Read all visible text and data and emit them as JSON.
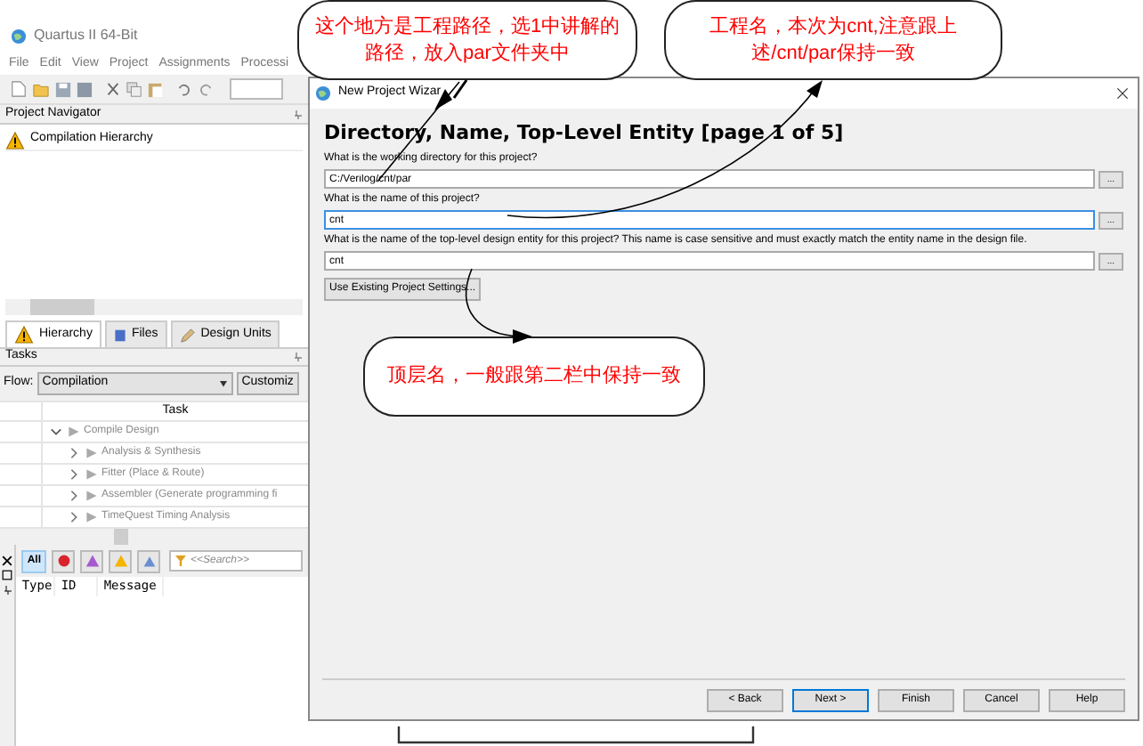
{
  "quartus": {
    "title": "Quartus II 64-Bit",
    "menu": [
      "File",
      "Edit",
      "View",
      "Project",
      "Assignments",
      "Processi"
    ],
    "navigator": {
      "title": "Project Navigator",
      "items": [
        "Compilation Hierarchy"
      ]
    },
    "tabs": [
      {
        "label": "Hierarchy",
        "selected": true
      },
      {
        "label": "Files",
        "selected": false
      },
      {
        "label": "Design Units",
        "selected": false
      }
    ],
    "tasks": {
      "title": "Tasks",
      "flow_label": "Flow:",
      "flow_value": "Compilation",
      "customize": "Customiz",
      "column": "Task",
      "rows": [
        {
          "label": "Compile Design",
          "expanded": true,
          "children": [
            {
              "label": "Analysis & Synthesis",
              "expanded": false
            },
            {
              "label": "Fitter (Place & Route)",
              "expanded": false
            },
            {
              "label": "Assembler (Generate programming fi",
              "expanded": false
            },
            {
              "label": "TimeQuest Timing Analysis",
              "expanded": false
            }
          ]
        }
      ]
    },
    "messages": {
      "all": "All",
      "search": {
        "placeholder": "<<Search>>"
      },
      "columns": [
        "Type",
        "ID",
        "Message"
      ]
    }
  },
  "wizard": {
    "title": "New Project Wizar",
    "heading": "Directory, Name, Top-Level Entity [page 1 of 5]",
    "fields": [
      {
        "label": "What is the working directory for this project?",
        "value": "C:/Verilog/cnt/par",
        "focused": false,
        "browse": "..."
      },
      {
        "label": "What is the name of this project?",
        "value": "cnt",
        "focused": true,
        "browse": "..."
      },
      {
        "label": "What is the name of the top-level design entity for this project? This name is case sensitive and must exactly match the entity name in the design file.",
        "value": "cnt",
        "focused": false,
        "browse": "..."
      }
    ],
    "use_existing": "Use Existing Project Settings...",
    "buttons": [
      {
        "label": "< Back",
        "default": false
      },
      {
        "label": "Next >",
        "default": true
      },
      {
        "label": "Finish",
        "default": false
      },
      {
        "label": "Cancel",
        "default": false
      },
      {
        "label": "Help",
        "default": false
      }
    ]
  },
  "callouts": [
    "这个地方是工程路径，选1中讲解的路径，放入par文件夹中",
    "工程名，本次为cnt,注意跟上述/cnt/par保持一致",
    "顶层名，一般跟第二栏中保持一致"
  ]
}
